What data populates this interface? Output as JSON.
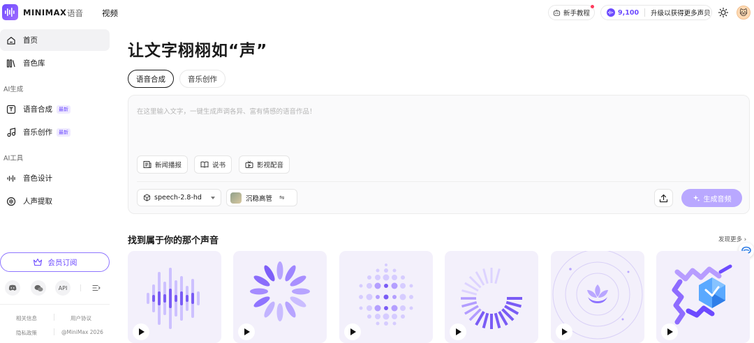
{
  "header": {
    "brand": "MINIMAX",
    "nav_voice": "语音",
    "nav_video": "视频",
    "tutorial": "新手教程",
    "credits_value": "9,100",
    "credits_cta": "升级以获得更多声贝",
    "avatar_emoji": "🐱"
  },
  "sidebar": {
    "home": "首页",
    "voice_library": "音色库",
    "section_ai_gen": "AI生成",
    "tts": "语音合成",
    "music": "音乐创作",
    "new_badge": "最新",
    "section_ai_tools": "AI工具",
    "voice_design": "音色设计",
    "voice_extract": "人声提取",
    "member": "会员订阅",
    "api": "API",
    "footer": {
      "about": "相关信息",
      "agreement": "用户协议",
      "privacy": "隐私政策",
      "copyright": "@MiniMax 2026"
    }
  },
  "main": {
    "title": "让文字栩栩如“声”",
    "tabs": [
      "语音合成",
      "音乐创作"
    ],
    "placeholder": "在这里输入文字，一键生成声调各异、富有情感的语音作品！",
    "chips": [
      "新闻播报",
      "说书",
      "影视配音"
    ],
    "model": "speech-2.8-hd",
    "voice": "沉稳高管",
    "generate": "生成音频",
    "section_title": "找到属于你的那个声音",
    "more": "发现更多"
  },
  "colors": {
    "accent": "#6d4bff",
    "accent_light": "#b9a8ff",
    "card_bg": "#f3f0fb"
  }
}
